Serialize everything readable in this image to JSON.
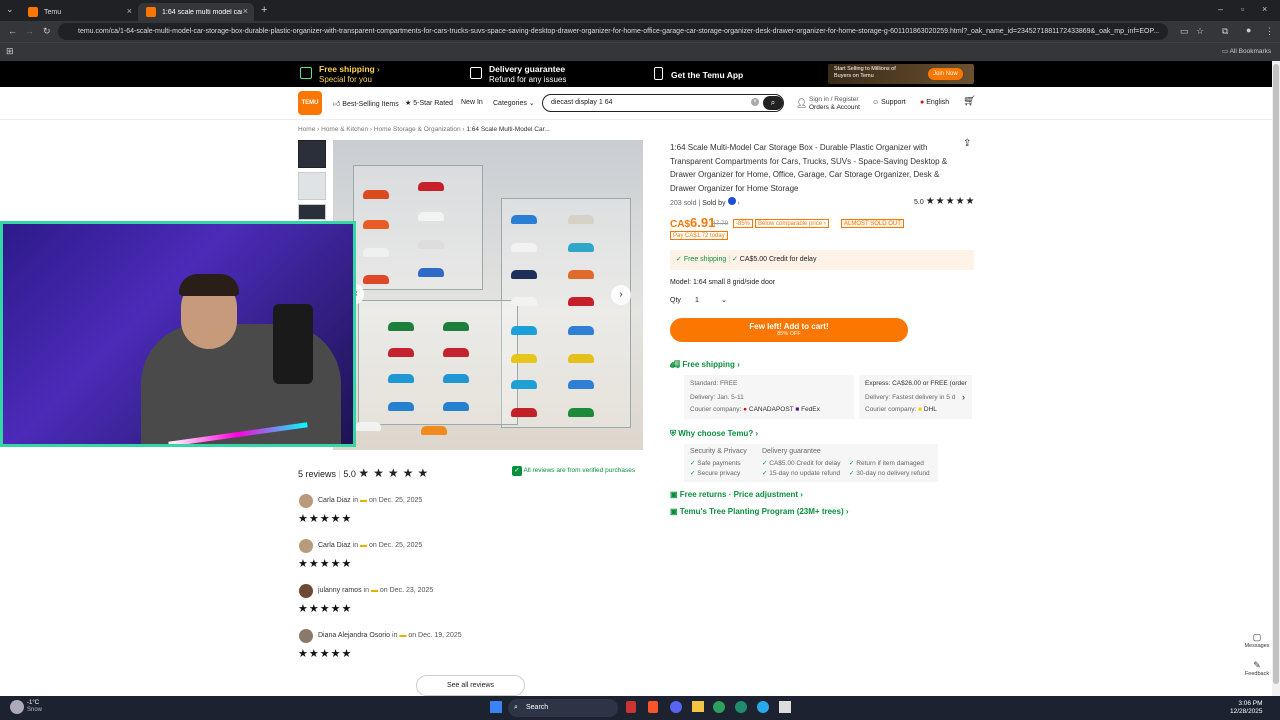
{
  "browser": {
    "tabs": [
      {
        "label": "Temu"
      },
      {
        "label": "1:64 scale multi model car stora"
      }
    ],
    "url": "temu.com/ca/1-64-scale-multi-model-car-storage-box-durable-plastic-organizer-with-transparent-compartments-for-cars-trucks-suvs-space-saving-desktop-drawer-organizer-for-home-office-garage-car-storage-organizer-desk-drawer-organizer-for-home-storage-g-601101863020259.html?_oak_name_id=2345271881172433869&_oak_mp_inf=EOP...",
    "all_bookmarks": "All Bookmarks"
  },
  "promo": {
    "free_shipping": "Free shipping",
    "special_for_you": "Special for you",
    "delivery_guarantee": "Delivery guarantee",
    "refund_for_issues": "Refund for any issues",
    "get_app": "Get the Temu App",
    "start_selling": "Start Selling to Millions of Buyers on Temu",
    "join_now": "Join Now"
  },
  "header": {
    "logo": "TEMU",
    "best_selling": "Best-Selling Items",
    "five_star": "5-Star Rated",
    "new_in": "New In",
    "categories": "Categories",
    "search_value": "diecast display 1 64",
    "sign_in": "Sign in / Register",
    "orders": "Orders & Account",
    "support": "Support",
    "language": "English"
  },
  "breadcrumb": [
    "Home",
    "Home & Kitchen",
    "Home Storage & Organization",
    "1:64 Scale Multi-Model Car..."
  ],
  "product": {
    "title": "1:64 Scale Multi-Model Car Storage Box - Durable Plastic Organizer with Transparent Compartments for Cars, Trucks, SUVs - Space-Saving Desktop & Drawer Organizer for Home, Office, Garage, Car Storage Organizer, Desk & Drawer Organizer for Home Storage",
    "sold": "203 sold",
    "sold_by": "Sold by",
    "rating": "5.0",
    "stars": "★★★★★",
    "currency": "CA$",
    "price": "6.91",
    "old_price": "47.79",
    "discount": "-85%",
    "below_price": "Below comparable price",
    "almost_sold_out": "ALMOST SOLD OUT",
    "pay_info": "Pay CA$1.72 today",
    "free_shipping": "Free shipping",
    "credit_delay": "CA$5.00 Credit for delay",
    "model_label": "Model:",
    "model_value": "1:64 small 8 grid/side door",
    "qty_label": "Qty",
    "qty_value": "1",
    "add_cart": "Few left! Add to cart!",
    "add_cart_sub": "85% OFF"
  },
  "shipping": {
    "title": "Free shipping",
    "standard": "Standard: FREE",
    "delivery": "Delivery: Jan. 5-11",
    "courier": "Courier company:",
    "courier1": "CANADAPOST",
    "courier2": "FedEx",
    "express": "Express: CA$26.00 or FREE (order",
    "express_delivery": "Delivery: Fastest delivery in 5 d",
    "courier3": "DHL"
  },
  "why": {
    "title": "Why choose Temu?",
    "security": "Security & Privacy",
    "safe_payments": "Safe payments",
    "secure_privacy": "Secure privacy",
    "delivery_guarantee": "Delivery guarantee",
    "credit": "CA$5.00 Credit for delay",
    "no_update": "15-day no update refund",
    "damaged": "Return if item damaged",
    "no_delivery": "30-day no delivery refund",
    "free_returns": "Free returns · Price adjustment",
    "tree": "Temu's Tree Planting Program (23M+ trees)"
  },
  "reviews": {
    "count": "5 reviews",
    "rating": "5.0",
    "verified": "All reviews are from verified purchases",
    "items": [
      {
        "name": "Carla Diaz",
        "in": "in",
        "date": "on Dec. 25, 2025"
      },
      {
        "name": "Carla Diaz",
        "in": "in",
        "date": "on Dec. 25, 2025"
      },
      {
        "name": "julanny ramos",
        "in": "in",
        "date": "on Dec. 23, 2025"
      },
      {
        "name": "Diana Alejandra Osorio",
        "in": "in",
        "date": "on Dec. 19, 2025"
      }
    ],
    "see_all": "See all reviews"
  },
  "side": {
    "messages": "Messages",
    "feedback": "Feedback"
  },
  "taskbar": {
    "weather_temp": "-1°C",
    "weather_desc": "Snow",
    "search": "Search",
    "time": "3:06 PM",
    "date": "12/28/2025"
  },
  "colors": {
    "brand": "#fb7701",
    "green": "#0a8f3c"
  }
}
